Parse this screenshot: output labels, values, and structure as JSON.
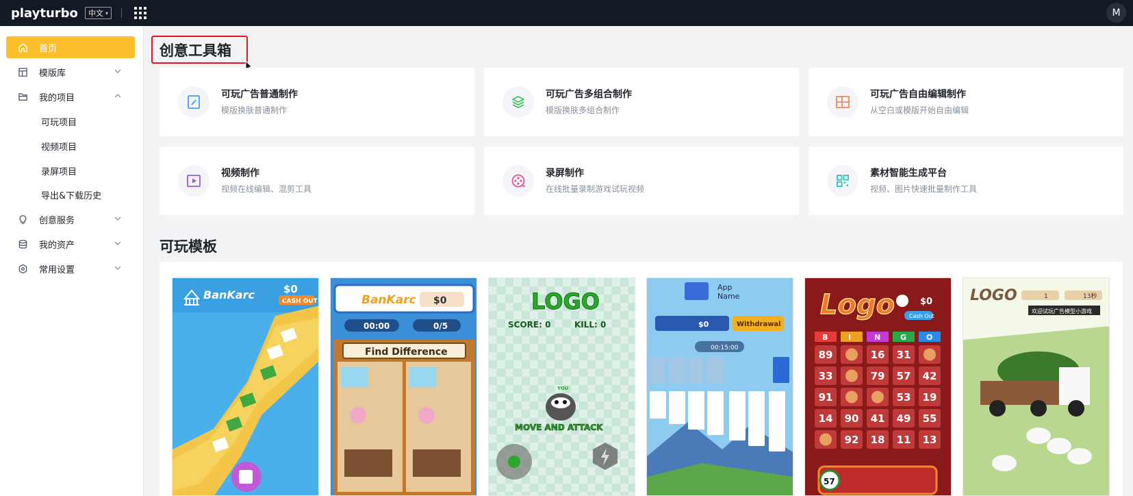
{
  "topbar": {
    "logo": "playturbo",
    "language": "中文",
    "avatar_initial": "M"
  },
  "sidebar": {
    "home": "首页",
    "templates": "模版库",
    "my_projects": "我的项目",
    "sub": {
      "playable": "可玩项目",
      "video": "视频项目",
      "recording": "录屏项目",
      "export": "导出&下载历史"
    },
    "creative_services": "创意服务",
    "my_assets": "我的资产",
    "settings": "常用设置"
  },
  "toolbox": {
    "title": "创意工具箱",
    "cards": [
      {
        "title": "可玩广告普通制作",
        "subtitle": "模版换肤普通制作",
        "icon": "tablet-icon",
        "color": "#4a9cf0"
      },
      {
        "title": "可玩广告多组合制作",
        "subtitle": "模版换肤多组合制作",
        "icon": "layers-icon",
        "color": "#3fbf5a"
      },
      {
        "title": "可玩广告自由编辑制作",
        "subtitle": "从空白或模版开始自由编辑",
        "icon": "layout-icon",
        "color": "#f08a5a"
      },
      {
        "title": "视频制作",
        "subtitle": "视频在线编辑、混剪工具",
        "icon": "video-icon",
        "color": "#9a5ad8"
      },
      {
        "title": "录屏制作",
        "subtitle": "在线批量录制游戏试玩视频",
        "icon": "film-reel-icon",
        "color": "#e8508a"
      },
      {
        "title": "素材智能生成平台",
        "subtitle": "视频、图片快速批量制作工具",
        "icon": "grid-icon",
        "color": "#2fc4b8"
      }
    ]
  },
  "playable_templates": {
    "title": "可玩模板",
    "items": [
      {
        "brand": "BanKarc",
        "cash": "$0",
        "cash_label": "CASH OUT"
      },
      {
        "brand": "BanKarc",
        "cash": "$0",
        "timer": "00:00",
        "count": "0/5",
        "banner": "Find Difference"
      },
      {
        "logo": "LOGO",
        "score": "SCORE:  0",
        "kill": "KILL:  0",
        "you": "YOU",
        "caption": "MOVE AND ATTACK"
      },
      {
        "app": "App",
        "name": "Name",
        "cash": "$0",
        "withdraw": "Withdrawal",
        "timer": "00:15:00"
      },
      {
        "logo": "Logo",
        "cash": "$0",
        "cash_out": "Cash Out",
        "letters": [
          "B",
          "I",
          "N",
          "G",
          "O"
        ],
        "numbers": [
          "89",
          "16",
          "31",
          "33",
          "79",
          "57",
          "42",
          "91",
          "53",
          "19",
          "14",
          "90",
          "41",
          "49",
          "55",
          "92",
          "18",
          "11",
          "13"
        ],
        "ball": "57"
      },
      {
        "logo": "LOGO",
        "count": "1",
        "time": "13秒",
        "caption": "欢迎试玩广告模型小游戏"
      }
    ]
  }
}
